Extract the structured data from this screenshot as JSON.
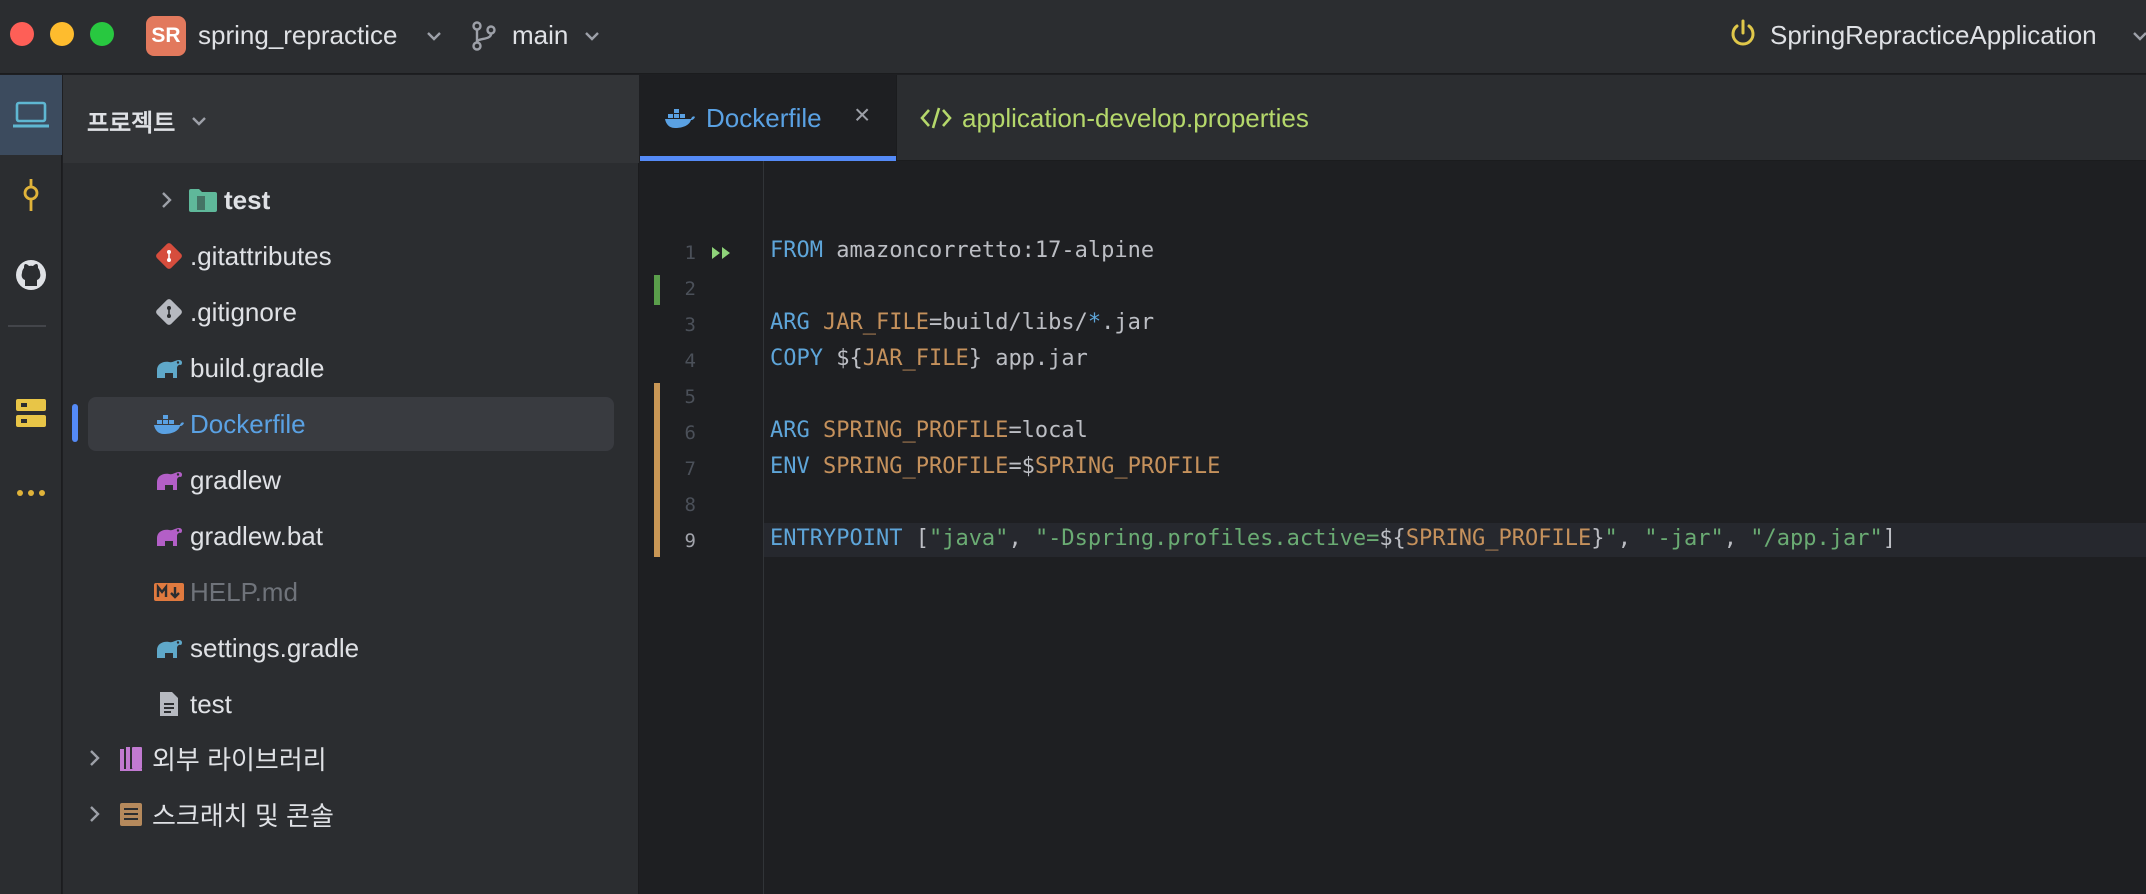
{
  "titlebar": {
    "project_badge": "SR",
    "project_name": "spring_repractice",
    "branch": "main",
    "run_config": "SpringRepracticeApplication"
  },
  "panel": {
    "title": "프로젝트",
    "items": [
      {
        "label": "test",
        "icon": "test-folder-icon"
      },
      {
        "label": ".gitattributes",
        "icon": "git-icon"
      },
      {
        "label": ".gitignore",
        "icon": "git-icon"
      },
      {
        "label": "build.gradle",
        "icon": "gradle-icon"
      },
      {
        "label": "Dockerfile",
        "icon": "docker-icon"
      },
      {
        "label": "gradlew",
        "icon": "gradle-icon"
      },
      {
        "label": "gradlew.bat",
        "icon": "gradle-icon"
      },
      {
        "label": "HELP.md",
        "icon": "markdown-icon"
      },
      {
        "label": "settings.gradle",
        "icon": "gradle-icon"
      },
      {
        "label": "test",
        "icon": "text-file-icon"
      },
      {
        "label": "외부 라이브러리",
        "icon": "library-icon"
      },
      {
        "label": "스크래치 및 콘솔",
        "icon": "scratch-icon"
      }
    ]
  },
  "tabs": [
    {
      "label": "Dockerfile",
      "close": "×"
    },
    {
      "label": "application-develop.properties"
    }
  ],
  "editor": {
    "line_numbers": [
      "1",
      "2",
      "3",
      "4",
      "5",
      "6",
      "7",
      "8",
      "9"
    ],
    "lines": [
      [
        {
          "t": "kw",
          "v": "FROM"
        },
        {
          "t": "plain",
          "v": " amazoncorretto:17-alpine"
        }
      ],
      [],
      [
        {
          "t": "kw",
          "v": "ARG"
        },
        {
          "t": "plain",
          "v": " "
        },
        {
          "t": "var",
          "v": "JAR_FILE"
        },
        {
          "t": "plain",
          "v": "=build/libs/"
        },
        {
          "t": "kw",
          "v": "*"
        },
        {
          "t": "plain",
          "v": ".jar"
        }
      ],
      [
        {
          "t": "kw",
          "v": "COPY"
        },
        {
          "t": "plain",
          "v": " ${"
        },
        {
          "t": "var",
          "v": "JAR_FILE"
        },
        {
          "t": "plain",
          "v": "} app.jar"
        }
      ],
      [],
      [
        {
          "t": "kw",
          "v": "ARG"
        },
        {
          "t": "plain",
          "v": " "
        },
        {
          "t": "var",
          "v": "SPRING_PROFILE"
        },
        {
          "t": "plain",
          "v": "=local"
        }
      ],
      [
        {
          "t": "kw",
          "v": "ENV"
        },
        {
          "t": "plain",
          "v": " "
        },
        {
          "t": "var",
          "v": "SPRING_PROFILE"
        },
        {
          "t": "plain",
          "v": "=$"
        },
        {
          "t": "var",
          "v": "SPRING_PROFILE"
        }
      ],
      [],
      [
        {
          "t": "kw",
          "v": "ENTRYPOINT"
        },
        {
          "t": "plain",
          "v": " ["
        },
        {
          "t": "str",
          "v": "\"java\""
        },
        {
          "t": "plain",
          "v": ", "
        },
        {
          "t": "str",
          "v": "\"-Dspring.profiles.active="
        },
        {
          "t": "plain",
          "v": "${"
        },
        {
          "t": "var",
          "v": "SPRING_PROFILE"
        },
        {
          "t": "plain",
          "v": "}"
        },
        {
          "t": "str",
          "v": "\""
        },
        {
          "t": "plain",
          "v": ", "
        },
        {
          "t": "str",
          "v": "\"-jar\""
        },
        {
          "t": "plain",
          "v": ", "
        },
        {
          "t": "str",
          "v": "\"/app.jar\""
        },
        {
          "t": "plain",
          "v": "]"
        }
      ]
    ]
  },
  "colors": {
    "accent": "#548af7",
    "keyword": "#5ea5d9",
    "variable": "#c5915c",
    "string": "#6aab73",
    "vcs_added": "#5a9e4b",
    "vcs_modified": "#c99756"
  }
}
